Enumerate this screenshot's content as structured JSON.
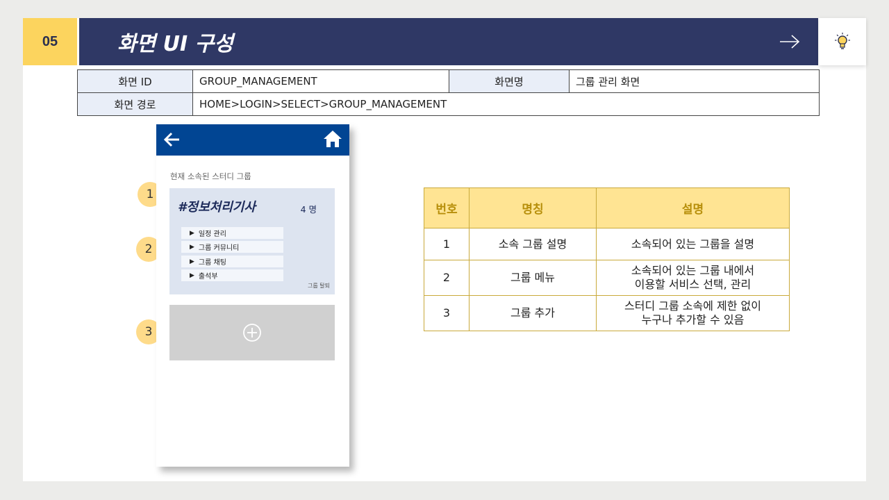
{
  "header": {
    "number": "05",
    "title": "화면 UI 구성"
  },
  "info": {
    "screen_id_label": "화면 ID",
    "screen_id": "GROUP_MANAGEMENT",
    "screen_name_label": "화면명",
    "screen_name": "그룹 관리 화면",
    "path_label": "화면 경로",
    "path": "HOME>LOGIN>SELECT>GROUP_MANAGEMENT"
  },
  "phone": {
    "current_group_label": "현재 소속된 스터디 그룹",
    "group_name": "#정보처리기사",
    "member_count": "4 명",
    "menu": [
      {
        "label": "일정 관리"
      },
      {
        "label": "그룹 커뮤니티"
      },
      {
        "label": "그룹 채팅"
      },
      {
        "label": "출석부"
      }
    ],
    "leave_label": "그룹 탈퇴",
    "icons": {
      "back": "back-arrow-icon",
      "home": "home-icon",
      "add": "plus-circle-icon"
    }
  },
  "badges": [
    "1",
    "2",
    "3"
  ],
  "desc_table": {
    "headers": [
      "번호",
      "명칭",
      "설명"
    ],
    "rows": [
      {
        "num": "1",
        "name": "소속 그룹 설명",
        "desc_lines": [
          "소속되어 있는 그룹을 설명"
        ]
      },
      {
        "num": "2",
        "name": "그룹 메뉴",
        "desc_lines": [
          "소속되어 있는 그룹 내에서",
          "이용할 서비스 선택, 관리"
        ]
      },
      {
        "num": "3",
        "name": "그룹 추가",
        "desc_lines": [
          "스터디 그룹 소속에 제한 없이",
          "누구나 추가할 수 있음"
        ]
      }
    ]
  },
  "colors": {
    "title_bar": "#2f3865",
    "number_box": "#fcd45e",
    "phone_bar": "#014593",
    "badge": "#fedb8a",
    "table_header": "#ffe493"
  }
}
